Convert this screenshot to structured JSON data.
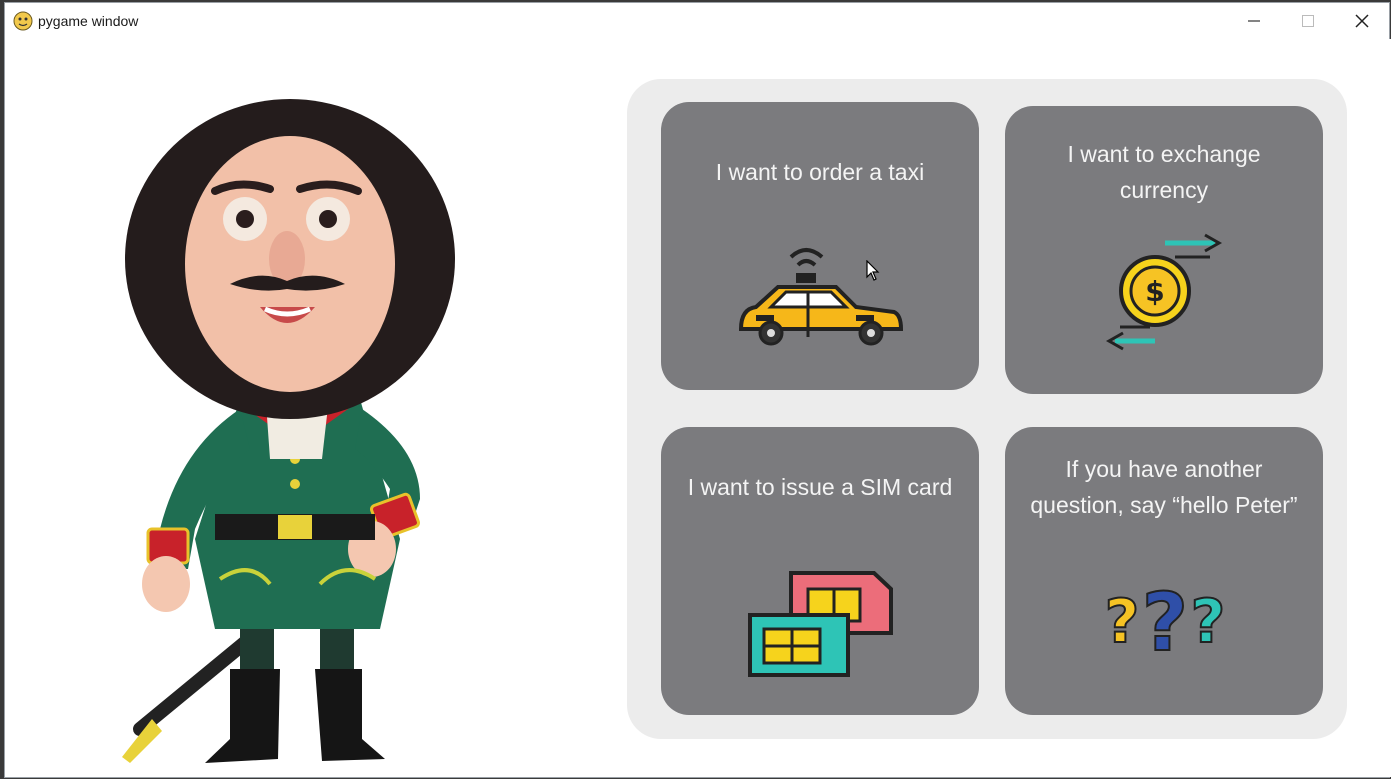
{
  "window": {
    "title": "pygame window",
    "controls": {
      "minimize_icon": "minimize-icon",
      "maximize_icon": "maximize-icon",
      "close_icon": "close-icon"
    }
  },
  "character": {
    "icon": "peter-character-image"
  },
  "options": [
    {
      "label": "I want to order a taxi",
      "icon": "taxi-icon"
    },
    {
      "label": "I want to exchange currency",
      "icon": "currency-exchange-icon"
    },
    {
      "label": "I want to issue a SIM card",
      "icon": "sim-card-icon"
    },
    {
      "label": "If you have another question, say “hello Peter”",
      "icon": "question-marks-icon"
    }
  ],
  "colors": {
    "card_bg": "#7b7b7e",
    "panel_bg": "#ececec",
    "card_text": "#f4f4f4",
    "accent_yellow": "#f6c324",
    "accent_teal": "#2ec4b6",
    "accent_blue": "#2f4fa8"
  }
}
